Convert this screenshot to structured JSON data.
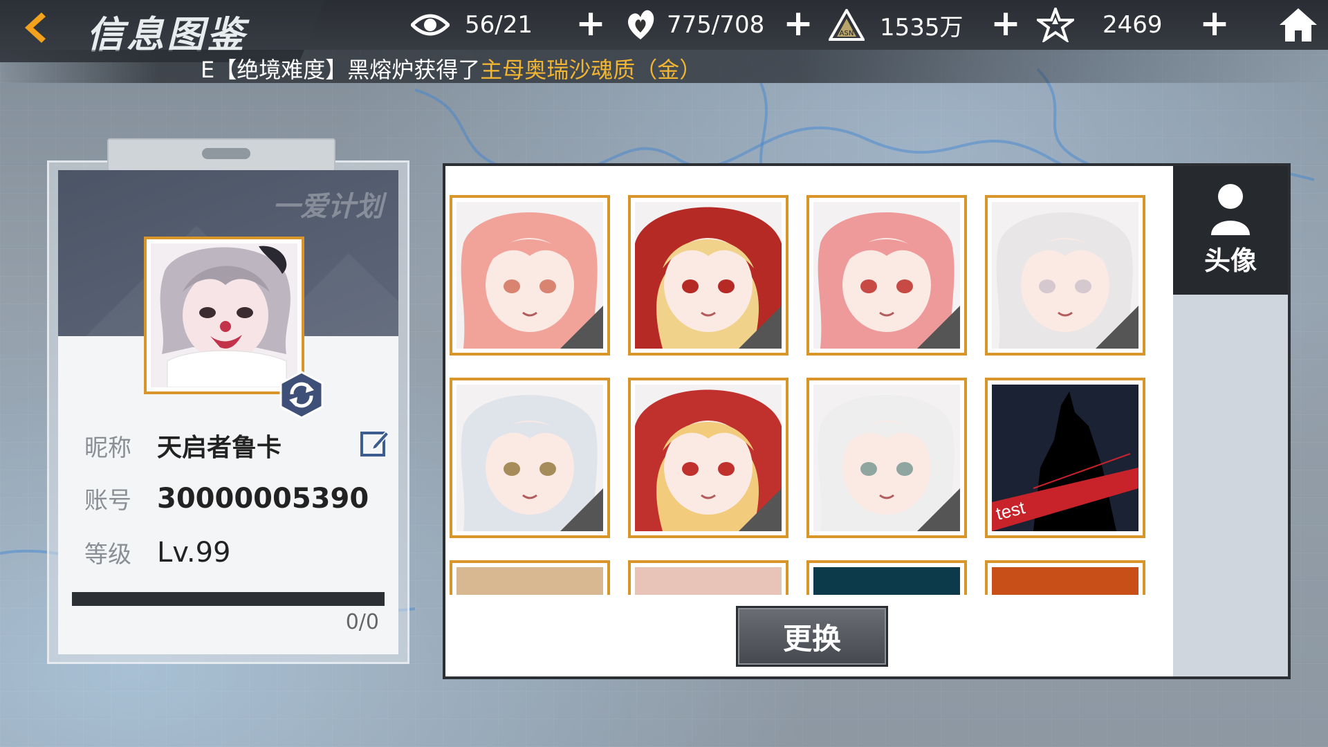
{
  "header": {
    "title": "信息图鉴",
    "resources": [
      {
        "icon": "eye-icon",
        "value": "56/21"
      },
      {
        "icon": "heart-flame-icon",
        "value": "775/708"
      },
      {
        "icon": "crystal-pyramid-icon",
        "value": "1535万"
      },
      {
        "icon": "star-crystal-icon",
        "value": "2469"
      }
    ]
  },
  "ticker": {
    "prefix": "E【绝境难度】黑熔炉获得了",
    "highlight": "主母奥瑞沙魂质（金）"
  },
  "profile": {
    "nickname_label": "昵称",
    "nickname": "天启者鲁卡",
    "account_label": "账号",
    "account": "30000005390",
    "level_label": "等级",
    "level": "Lv.99",
    "xp": "0/0",
    "xp_fraction": 1.0,
    "logo_text": "一爱计划"
  },
  "panel": {
    "tab_label": "头像",
    "change_button": "更换",
    "tiles": [
      {
        "name": "avatar-tile-pink-hair-salute",
        "hair": "#f1a39a",
        "accent": "#d88470",
        "hood": ""
      },
      {
        "name": "avatar-tile-blonde-red-hood",
        "hair": "#f0d28a",
        "accent": "#b62a26",
        "hood": "red"
      },
      {
        "name": "avatar-tile-pink-glasses",
        "hair": "#ef9a9a",
        "accent": "#c74a44",
        "hood": ""
      },
      {
        "name": "avatar-tile-silver-hair",
        "hair": "#e9e6e8",
        "accent": "#d5c9cf",
        "hood": ""
      },
      {
        "name": "avatar-tile-silver-horns",
        "hair": "#dfe3ea",
        "accent": "#a58c5a",
        "hood": ""
      },
      {
        "name": "avatar-tile-chibi-red-hood",
        "hair": "#f2cc7c",
        "accent": "#c0302c",
        "hood": "red"
      },
      {
        "name": "avatar-tile-white-hair-wink",
        "hair": "#eeeeee",
        "accent": "#8fa6a0",
        "hood": ""
      },
      {
        "name": "avatar-tile-test-silhouette",
        "hair": "#1b2234",
        "accent": "#c8222a",
        "hood": "",
        "label": "test"
      }
    ]
  }
}
